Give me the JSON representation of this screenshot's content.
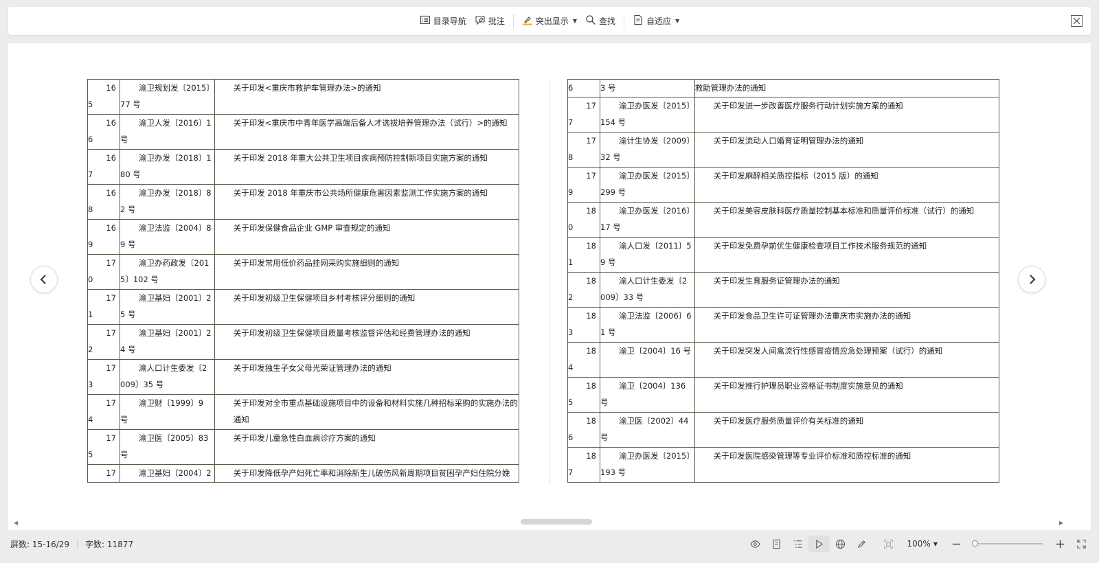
{
  "toolbar": {
    "toc_label": "目录导航",
    "comment_label": "批注",
    "highlight_label": "突出显示",
    "find_label": "查找",
    "fit_label": "自适应"
  },
  "left_table": [
    {
      "n1": "16",
      "n2": "5",
      "d1": "渝卫规划发〔2015〕",
      "d2": "77 号",
      "t": "关于印发<重庆市救护车管理办法>的通知"
    },
    {
      "n1": "16",
      "n2": "6",
      "d1": "渝卫人发〔2016〕1",
      "d2": "号",
      "t": "关于印发<重庆市中青年医学高端后备人才选拔培养管理办法（试行）>的通知"
    },
    {
      "n1": "16",
      "n2": "7",
      "d1": "渝卫办发〔2018〕1",
      "d2": "80 号",
      "t": "关于印发 2018 年重大公共卫生项目疾病预防控制新项目实施方案的通知"
    },
    {
      "n1": "16",
      "n2": "8",
      "d1": "渝卫办发〔2018〕8",
      "d2": "2 号",
      "t": "关于印发 2018 年重庆市公共场所健康危害因素监测工作实施方案的通知"
    },
    {
      "n1": "16",
      "n2": "9",
      "d1": "渝卫法监〔2004〕8",
      "d2": "9 号",
      "t": "关于印发保健食品企业 GMP 审查规定的通知"
    },
    {
      "n1": "17",
      "n2": "0",
      "d1": "渝卫办药政发〔201",
      "d2": "5〕102 号",
      "t": "关于印发常用低价药品挂网采购实施细则的通知"
    },
    {
      "n1": "17",
      "n2": "1",
      "d1": "渝卫基妇〔2001〕2",
      "d2": "5 号",
      "t": "关于印发初级卫生保健项目乡村考核评分细则的通知"
    },
    {
      "n1": "17",
      "n2": "2",
      "d1": "渝卫基妇〔2001〕2",
      "d2": "4 号",
      "t": "关于印发初级卫生保健项目质量考核监督评估和经费管理办法的通知"
    },
    {
      "n1": "17",
      "n2": "3",
      "d1": "渝人口计生委发〔2",
      "d2": "009〕35 号",
      "t": "关于印发独生子女父母光荣证管理办法的通知"
    },
    {
      "n1": "17",
      "n2": "4",
      "d1": "渝卫财〔1999〕9",
      "d2": "号",
      "t": "关于印发对全市重点基础设施项目中的设备和材料实施几种招标采购的实施办法的通知"
    },
    {
      "n1": "17",
      "n2": "5",
      "d1": "渝卫医〔2005〕83",
      "d2": "号",
      "t": "关于印发儿童急性白血病诊疗方案的通知"
    },
    {
      "n1": "17",
      "n2": "",
      "d1": "渝卫基妇〔2004〕2",
      "d2": "",
      "t": "关于印发降低孕产妇死亡率和消除新生儿破伤风新周期项目贫困孕产妇住院分娩"
    }
  ],
  "right_table": [
    {
      "n1": "6",
      "n2": "",
      "d1": "3 号",
      "d2": "",
      "t": "救助管理办法的通知"
    },
    {
      "n1": "17",
      "n2": "7",
      "d1": "渝卫办医发〔2015〕",
      "d2": "154 号",
      "t": "关于印发进一步改善医疗服务行动计划实施方案的通知"
    },
    {
      "n1": "17",
      "n2": "8",
      "d1": "渝计生协发〔2009〕",
      "d2": "32 号",
      "t": "关于印发流动人口婚育证明管理办法的通知"
    },
    {
      "n1": "17",
      "n2": "9",
      "d1": "渝卫办医发〔2015〕",
      "d2": "299 号",
      "t": "关于印发麻醉相关质控指标（2015 版）的通知"
    },
    {
      "n1": "18",
      "n2": "0",
      "d1": "渝卫办医发〔2016〕",
      "d2": "17 号",
      "t": "关于印发美容皮肤科医疗质量控制基本标准和质量评价标准（试行）的通知"
    },
    {
      "n1": "18",
      "n2": "1",
      "d1": "渝人口发〔2011〕5",
      "d2": "9 号",
      "t": "关于印发免费孕前优生健康检查项目工作技术服务规范的通知"
    },
    {
      "n1": "18",
      "n2": "2",
      "d1": "渝人口计生委发〔2",
      "d2": "009〕33 号",
      "t": "关于印发生育服务证管理办法的通知"
    },
    {
      "n1": "18",
      "n2": "3",
      "d1": "渝卫法监〔2006〕6",
      "d2": "1 号",
      "t": "关于印发食品卫生许可证管理办法重庆市实施办法的通知"
    },
    {
      "n1": "18",
      "n2": "4",
      "d1": "渝卫〔2004〕16 号",
      "d2": "",
      "t": "关于印发突发人间禽流行性感冒疫情应急处理预案（试行）的通知"
    },
    {
      "n1": "18",
      "n2": "5",
      "d1": "渝卫〔2004〕136",
      "d2": "号",
      "t": "关于印发推行护理员职业资格证书制度实施意见的通知"
    },
    {
      "n1": "18",
      "n2": "6",
      "d1": "渝卫医〔2002〕44",
      "d2": "号",
      "t": "关于印发医疗服务质量评价有关标准的通知"
    },
    {
      "n1": "18",
      "n2": "7",
      "d1": "渝卫办医发〔2015〕",
      "d2": "193 号",
      "t": "关于印发医院感染管理等专业评价标准和质控标准的通知"
    }
  ],
  "status": {
    "screen": "屏数: 15-16/29",
    "words": "字数: 11877",
    "zoom": "100%"
  }
}
